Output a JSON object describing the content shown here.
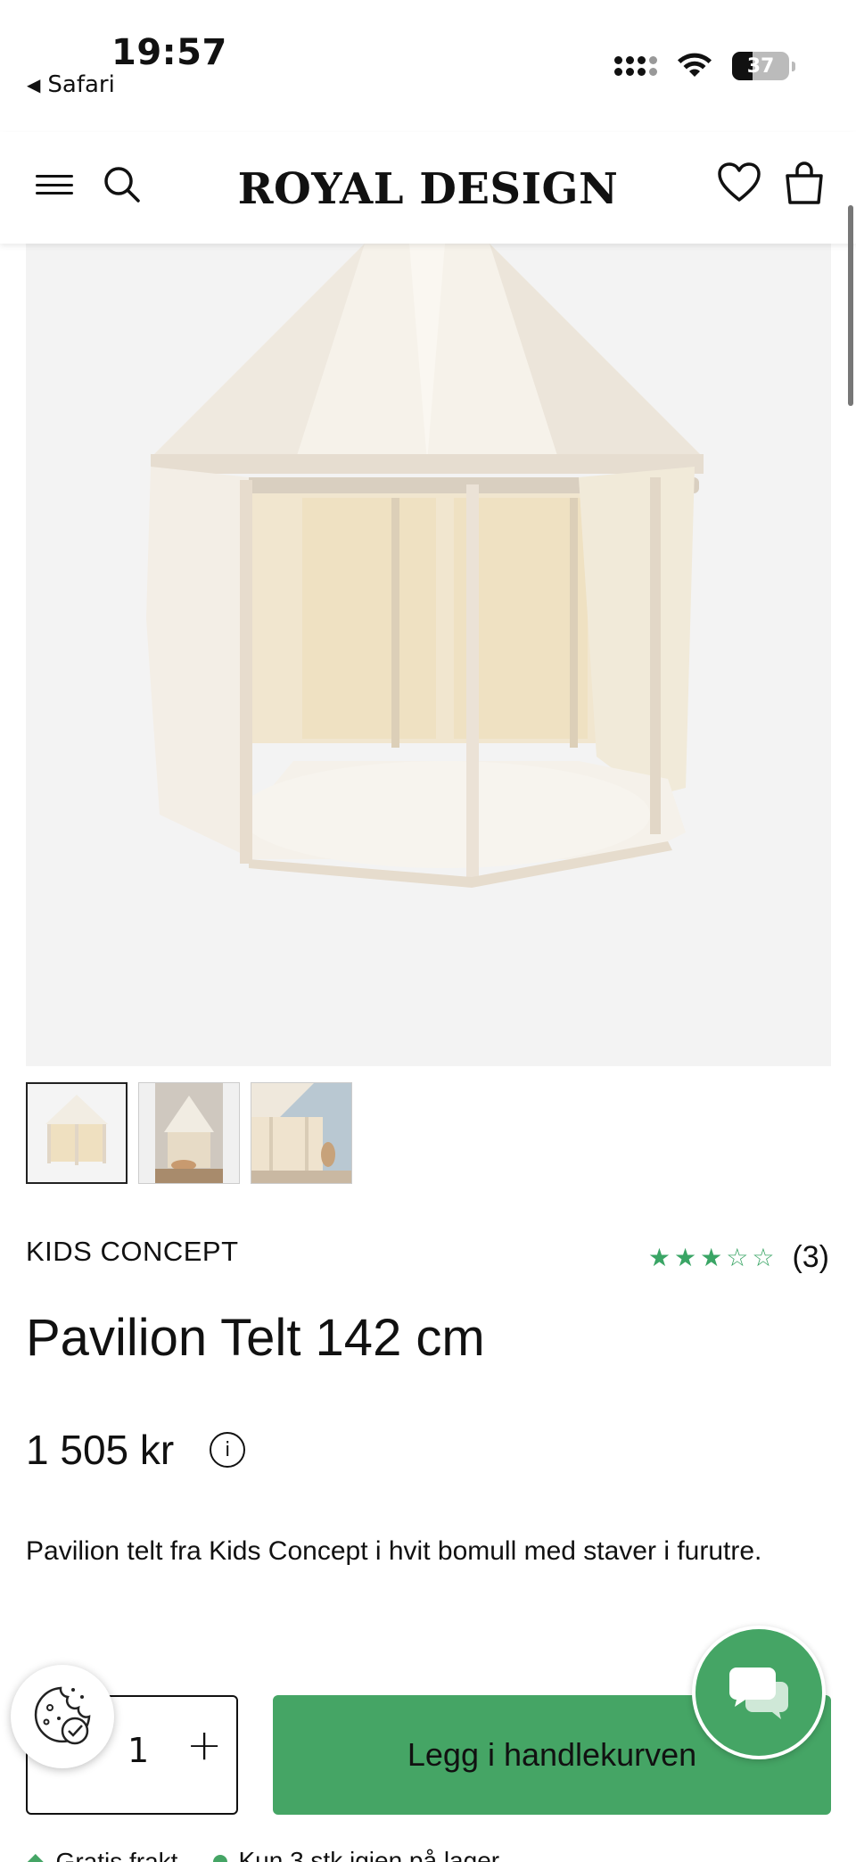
{
  "status_bar": {
    "time": "19:57",
    "back_app": "Safari",
    "battery": "37"
  },
  "header": {
    "logo": "ROYAL DESIGN"
  },
  "product": {
    "brand": "KIDS CONCEPT",
    "rating_stars": 3,
    "rating_max": 5,
    "rating_count": "(3)",
    "title": "Pavilion Telt 142 cm",
    "price": "1 505 kr",
    "description": "Pavilion telt fra Kids Concept i hvit bomull med staver i furutre."
  },
  "cart": {
    "quantity": "1",
    "plus_label": "+",
    "add_label": "Legg i handlekurven"
  },
  "footer_info": {
    "shipping": "Gratis frakt",
    "stock": "Kun 3 stk igjen på lager"
  },
  "colors": {
    "accent": "#45a565",
    "hero_bg": "#f3f3f3"
  }
}
